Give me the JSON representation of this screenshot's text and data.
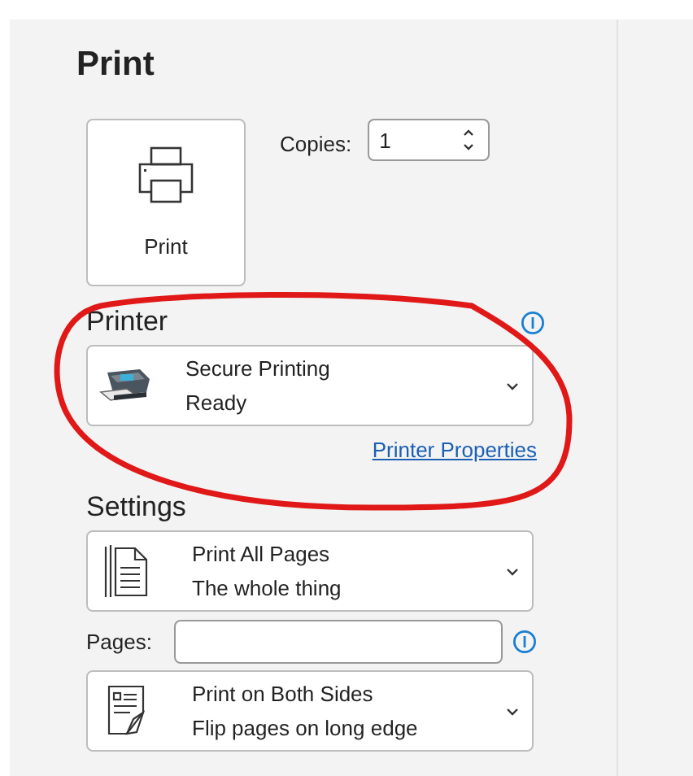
{
  "title": "Print",
  "print_button": {
    "label": "Print"
  },
  "copies": {
    "label": "Copies:",
    "value": "1"
  },
  "printer": {
    "heading": "Printer",
    "name": "Secure Printing",
    "status": "Ready",
    "properties_link": "Printer Properties"
  },
  "settings": {
    "heading": "Settings",
    "items": [
      {
        "kind": "dropdown",
        "title": "Print All Pages",
        "subtitle": "The whole thing"
      },
      {
        "kind": "field",
        "label": "Pages:"
      },
      {
        "kind": "dropdown",
        "title": "Print on Both Sides",
        "subtitle": "Flip pages on long edge"
      }
    ]
  }
}
